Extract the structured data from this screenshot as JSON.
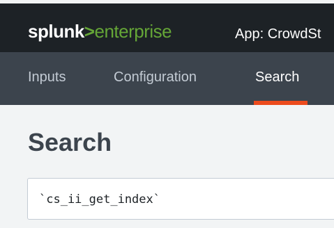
{
  "header": {
    "logo_brand": "splunk",
    "logo_separator": ">",
    "logo_product": "enterprise",
    "app_label": "App: CrowdSt"
  },
  "nav": {
    "items": [
      {
        "label": "Inputs"
      },
      {
        "label": "Configuration"
      },
      {
        "label": "Search",
        "active": true
      }
    ]
  },
  "main": {
    "title": "Search",
    "search_query": "`cs_ii_get_index`"
  },
  "colors": {
    "topbar_bg": "#1d2226",
    "navbar_bg": "#3c444d",
    "brand_green": "#65a637",
    "active_underline": "#ec4b1d",
    "page_bg": "#f2f4f5",
    "title_text": "#3c444d"
  }
}
